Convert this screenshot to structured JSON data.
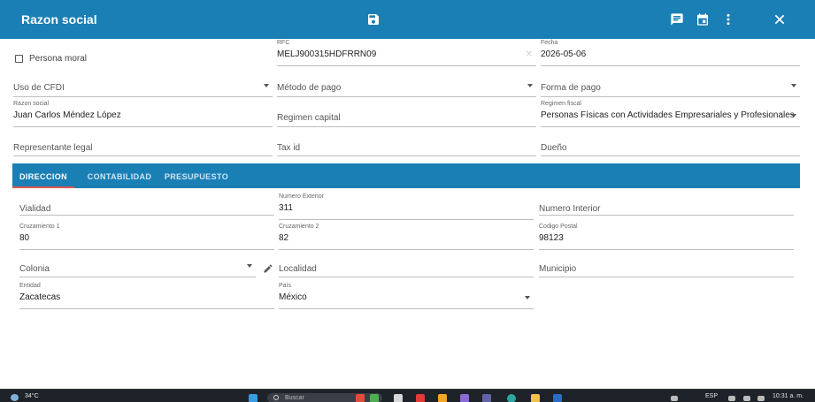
{
  "header": {
    "title": "Razon social",
    "icons": [
      "save-icon",
      "chat-icon",
      "calendar-icon",
      "more-vert-icon",
      "close-icon"
    ]
  },
  "form": {
    "persona_moral": {
      "label": "Persona moral",
      "checked": false
    },
    "rfc": {
      "label": "RFC",
      "value": "MELJ900315HDFRRN09"
    },
    "fecha": {
      "label": "Fecha",
      "value": "2026-05-06"
    },
    "uso_cfdi": {
      "placeholder": "Uso de CFDI"
    },
    "metodo_pago": {
      "placeholder": "Método de pago"
    },
    "forma_pago": {
      "placeholder": "Forma de pago"
    },
    "razon_social": {
      "label": "Razon social",
      "value": "Juan Carlos Méndez López"
    },
    "regimen_capital": {
      "placeholder": "Regimen capital"
    },
    "regimen_fiscal": {
      "label": "Regimen fiscal",
      "value": "Personas Físicas con Actividades Empresariales y Profesionales"
    },
    "representante_legal": {
      "placeholder": "Representante legal"
    },
    "tax_id": {
      "placeholder": "Tax id"
    },
    "dueno": {
      "placeholder": "Dueño"
    }
  },
  "tabs": [
    {
      "label": "DIRECCION",
      "active": true
    },
    {
      "label": "CONTABILIDAD",
      "active": false
    },
    {
      "label": "PRESUPUESTO",
      "active": false
    }
  ],
  "direccion": {
    "vialidad": {
      "placeholder": "Vialidad"
    },
    "numero_exterior": {
      "label": "Numero Exterior",
      "value": "311"
    },
    "numero_interior": {
      "placeholder": "Numero Interior"
    },
    "cruzamiento1": {
      "label": "Cruzamiento 1",
      "value": "80"
    },
    "cruzamiento2": {
      "label": "Cruzamiento 2",
      "value": "82"
    },
    "codigo_postal": {
      "label": "Codigo Postal",
      "value": "98123"
    },
    "colonia": {
      "placeholder": "Colonia"
    },
    "localidad": {
      "placeholder": "Localidad"
    },
    "municipio": {
      "placeholder": "Municipio"
    },
    "entidad": {
      "label": "Entidad",
      "value": "Zacatecas"
    },
    "pais": {
      "label": "País",
      "value": "México"
    }
  },
  "taskbar": {
    "weather": "34°C",
    "search_placeholder": "Buscar",
    "language": "ESP",
    "time": "10:31 a. m."
  },
  "colors": {
    "primary": "#1a7fb5",
    "tab_indicator": "#e0544f",
    "taskbar": "#1e2229"
  }
}
